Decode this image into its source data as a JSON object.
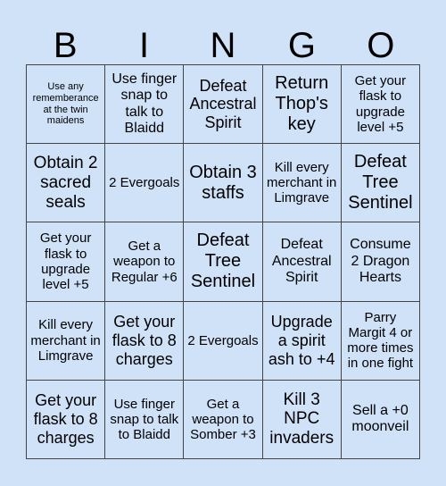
{
  "header": {
    "letters": [
      "B",
      "I",
      "N",
      "G",
      "O"
    ]
  },
  "colors": {
    "background": "#cfe2f8",
    "grid_line": "#444444"
  },
  "board": {
    "rows": [
      [
        "Use any rememberance at the twin maidens",
        "Use finger snap to talk to Blaidd",
        "Defeat Ancestral Spirit",
        "Return Thop's key",
        "Get your flask to upgrade level +5"
      ],
      [
        "Obtain 2 sacred seals",
        "2 Evergoals",
        "Obtain 3 staffs",
        "Kill every merchant in Limgrave",
        "Defeat Tree Sentinel"
      ],
      [
        "Get your flask to upgrade level +5",
        "Get a weapon to Regular +6",
        "Defeat Tree Sentinel",
        "Defeat Ancestral Spirit",
        "Consume 2 Dragon Hearts"
      ],
      [
        "Kill every merchant in Limgrave",
        "Get your flask to 8 charges",
        "2 Evergoals",
        "Upgrade a spirit ash to +4",
        "Parry Margit 4 or more times in one fight"
      ],
      [
        "Get your flask to 8 charges",
        "Use finger snap to talk to Blaidd",
        "Get a weapon to Somber +3",
        "Kill 3 NPC invaders",
        "Sell a +0 moonveil"
      ]
    ]
  }
}
